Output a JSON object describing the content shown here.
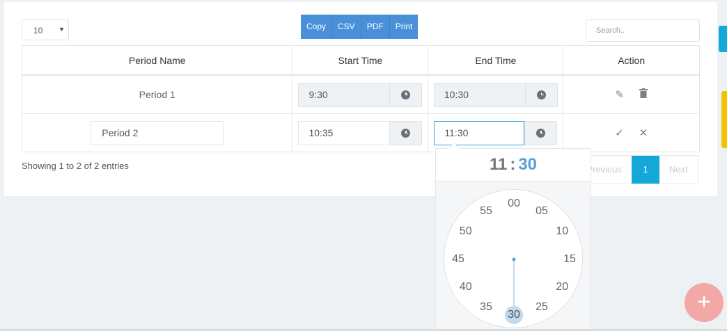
{
  "length_select": {
    "value": "10"
  },
  "export_buttons": [
    "Copy",
    "CSV",
    "PDF",
    "Print"
  ],
  "search": {
    "placeholder": "Search.."
  },
  "table": {
    "headers": [
      "Period Name",
      "Start Time",
      "End Time",
      "Action"
    ],
    "rows": [
      {
        "name": "Period 1",
        "start": "9:30",
        "end": "10:30"
      },
      {
        "name": "Period 2",
        "start": "10:35",
        "end": "11:30"
      }
    ]
  },
  "info": "Showing 1 to 2 of 2 entries",
  "pager": {
    "prev": "Previous",
    "current": "1",
    "next": "Next"
  },
  "clockpicker": {
    "hours": "11",
    "separator": ":",
    "minutes": "30",
    "ticks": [
      "00",
      "05",
      "10",
      "15",
      "20",
      "25",
      "30",
      "35",
      "40",
      "45",
      "50",
      "55"
    ],
    "selected_index": 6,
    "accent": "#5aa0d6"
  },
  "icons": {
    "clock": "clock-icon",
    "edit": "pencil-icon",
    "delete": "trash-icon",
    "save": "check-icon",
    "cancel": "close-icon",
    "fab": "plus-icon"
  },
  "colors": {
    "primary": "#4a90d9",
    "active_page": "#14a8d8",
    "fab": "#f4a7a7",
    "side_tab_blue": "#14a8d8",
    "side_tab_yellow": "#f2c200"
  }
}
